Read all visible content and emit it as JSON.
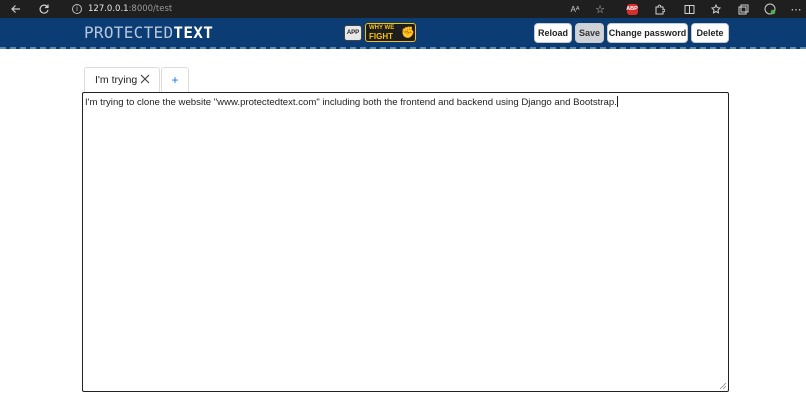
{
  "browser": {
    "host": "127.0.0.1",
    "path": ":8000/test",
    "info_icon": "i",
    "read_aloud": "Aᴬ",
    "adblock_label": "ABP"
  },
  "header": {
    "logo_thin": "PROTECTED",
    "logo_bold": "TEXT",
    "app_label": "APP",
    "fight_line1": "WHY WE",
    "fight_line2": "FIGHT",
    "buttons": {
      "reload": "Reload",
      "save": "Save",
      "change_password": "Change password",
      "delete": "Delete"
    },
    "colors": {
      "bar": "#0c3c74",
      "badge": "#f6c20b"
    }
  },
  "tabs": {
    "items": [
      {
        "label": "I'm trying"
      }
    ],
    "add_label": "+"
  },
  "editor": {
    "content": "I'm trying to clone the website \"www.protectedtext.com\" including both the frontend and backend using Django and Bootstrap."
  }
}
